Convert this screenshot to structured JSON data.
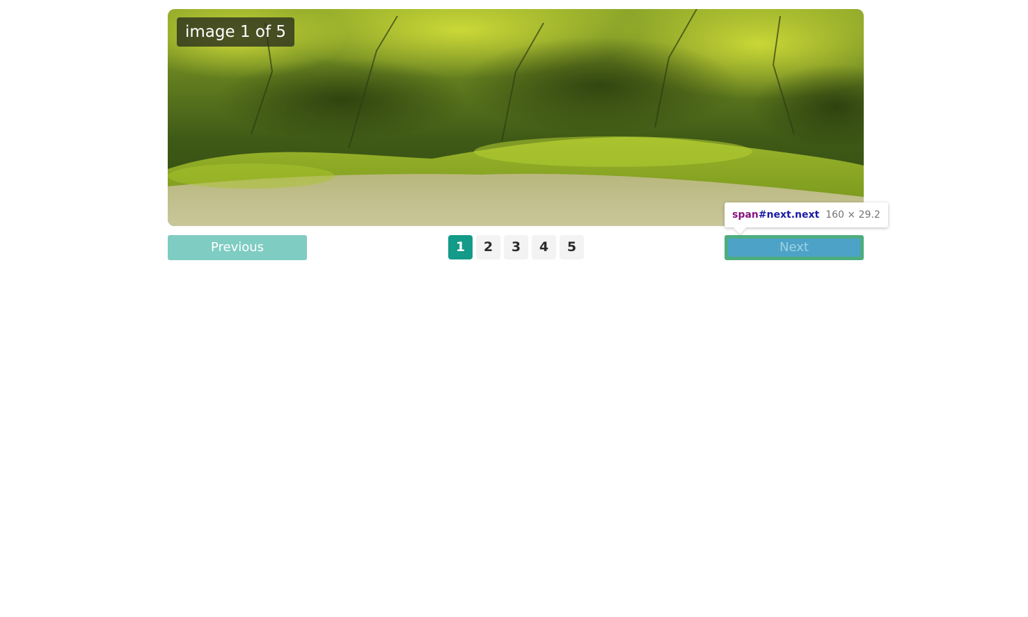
{
  "slider": {
    "caption": "image 1 of 5",
    "image_alt": "moss-covered forest floor"
  },
  "controls": {
    "previous_label": "Previous",
    "next_label": "Next",
    "pages": [
      "1",
      "2",
      "3",
      "4",
      "5"
    ],
    "active_page": 1
  },
  "devtools_tooltip": {
    "tag": "span",
    "selector": "#next.next",
    "dimensions": "160 × 29.2"
  },
  "colors": {
    "active_page_bg": "#139a88",
    "previous_bg": "#7fccc2",
    "next_highlight_content": "#4ca3c7",
    "next_highlight_padding": "#4ead7f"
  }
}
